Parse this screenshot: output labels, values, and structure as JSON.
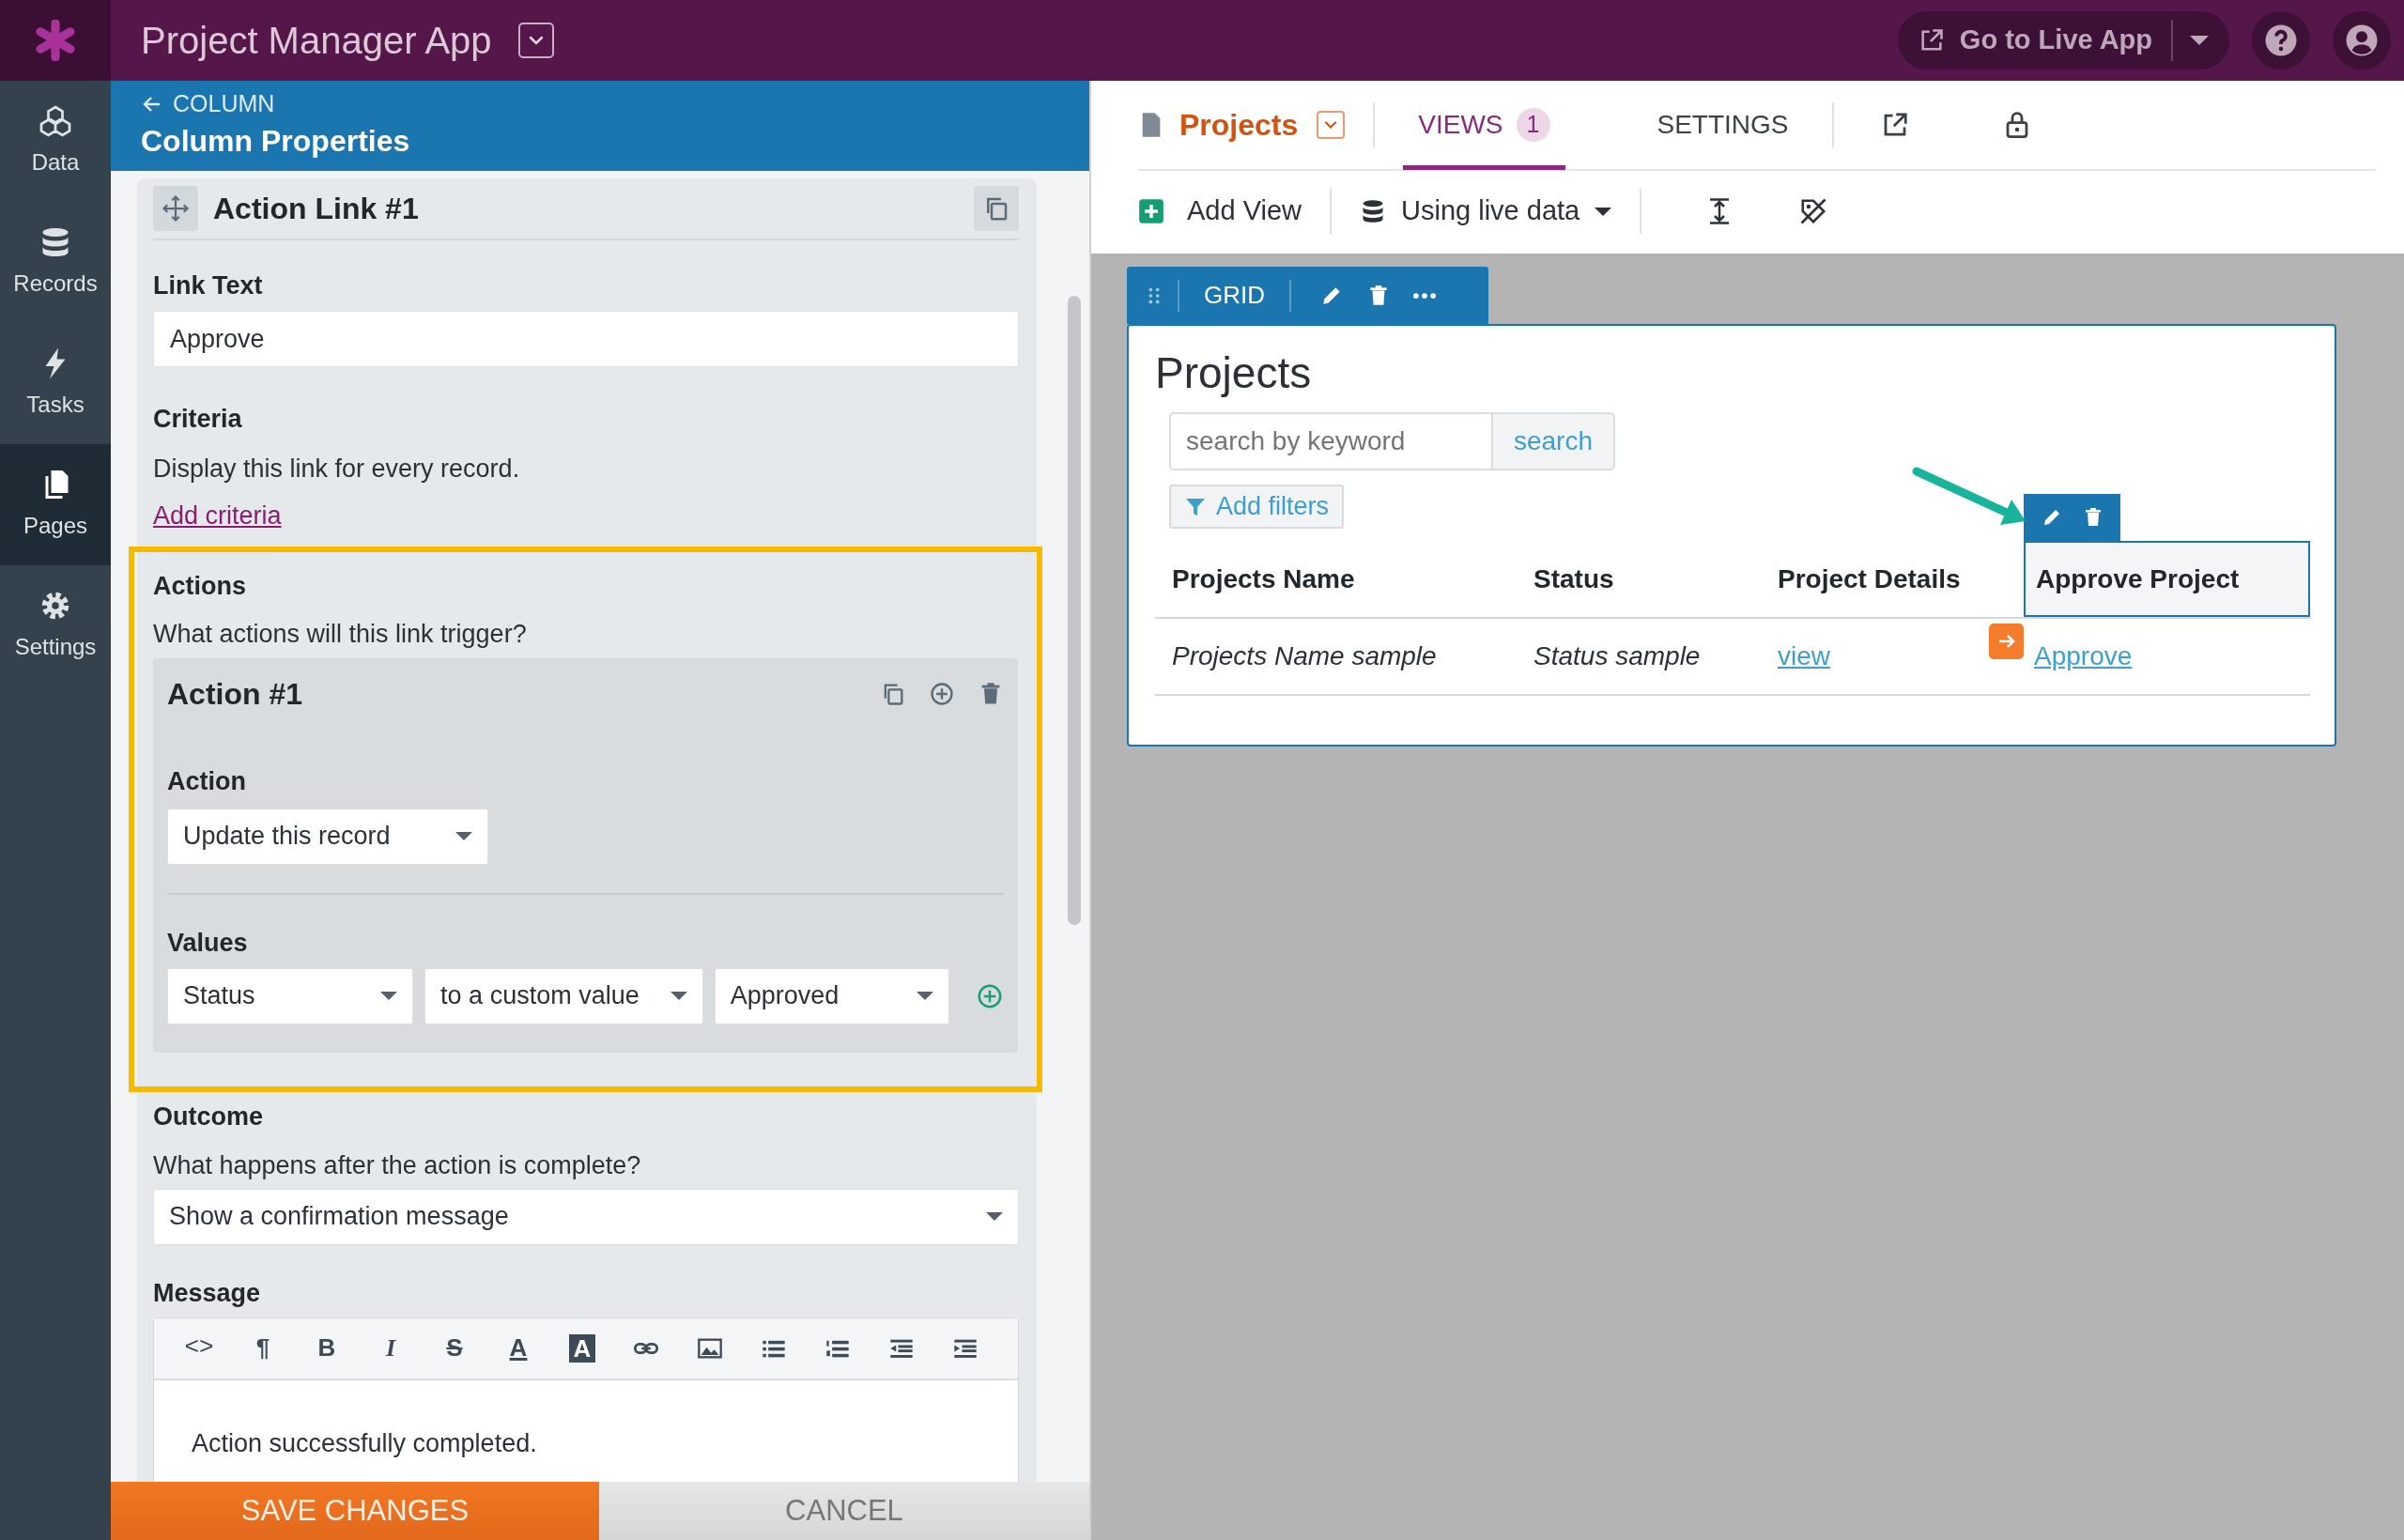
{
  "app": {
    "title": "Project Manager App",
    "live_app": "Go to Live App"
  },
  "nav": [
    {
      "label": "Data",
      "selected": false
    },
    {
      "label": "Records",
      "selected": false
    },
    {
      "label": "Tasks",
      "selected": false
    },
    {
      "label": "Pages",
      "selected": true
    },
    {
      "label": "Settings",
      "selected": false
    }
  ],
  "panel": {
    "back": "COLUMN",
    "title": "Column Properties",
    "item_title": "Action Link #1",
    "link_text": {
      "label": "Link Text",
      "value": "Approve"
    },
    "criteria": {
      "label": "Criteria",
      "text": "Display this link for every record.",
      "link": "Add criteria"
    },
    "actions": {
      "label": "Actions",
      "prompt": "What actions will this link trigger?",
      "highlighted": true,
      "action": {
        "title": "Action #1",
        "action_label": "Action",
        "action_value": "Update this record",
        "values_label": "Values",
        "values": [
          "Status",
          "to a custom value",
          "Approved"
        ]
      }
    },
    "outcome": {
      "label": "Outcome",
      "prompt": "What happens after the action is complete?",
      "value": "Show a confirmation message"
    },
    "message": {
      "label": "Message",
      "body": "Action successfully completed.",
      "toolbar": [
        {
          "kind": "code",
          "text": "<>"
        },
        {
          "kind": "para",
          "text": "¶"
        },
        {
          "kind": "bold",
          "text": "B"
        },
        {
          "kind": "italic",
          "text": "I"
        },
        {
          "kind": "strike",
          "text": "S"
        },
        {
          "kind": "color",
          "text": "A"
        },
        {
          "kind": "highlight",
          "text": "A"
        },
        {
          "kind": "link"
        },
        {
          "kind": "image"
        },
        {
          "kind": "bullets"
        },
        {
          "kind": "numbers"
        },
        {
          "kind": "outdent"
        },
        {
          "kind": "indent"
        }
      ]
    },
    "buttons": {
      "save": "SAVE CHANGES",
      "cancel": "CANCEL"
    }
  },
  "page": {
    "title": "Projects",
    "tabs": [
      {
        "label": "VIEWS",
        "badge": "1",
        "selected": true
      },
      {
        "label": "SETTINGS",
        "selected": false
      }
    ],
    "toolbar": {
      "add_view": "Add View",
      "data_source": "Using live data"
    },
    "view": {
      "tool_label": "GRID",
      "title": "Projects",
      "search_placeholder": "search by keyword",
      "search_button": "search",
      "filters": "Add filters",
      "columns": [
        {
          "label": "Projects Name",
          "kind": "text",
          "selected": false
        },
        {
          "label": "Status",
          "kind": "text",
          "selected": false
        },
        {
          "label": "Project Details",
          "kind": "link",
          "selected": false
        },
        {
          "label": "Approve Project",
          "kind": "link",
          "selected": true
        }
      ],
      "rows": [
        [
          "Projects Name sample",
          "Status sample",
          "view",
          "Approve"
        ]
      ]
    }
  }
}
